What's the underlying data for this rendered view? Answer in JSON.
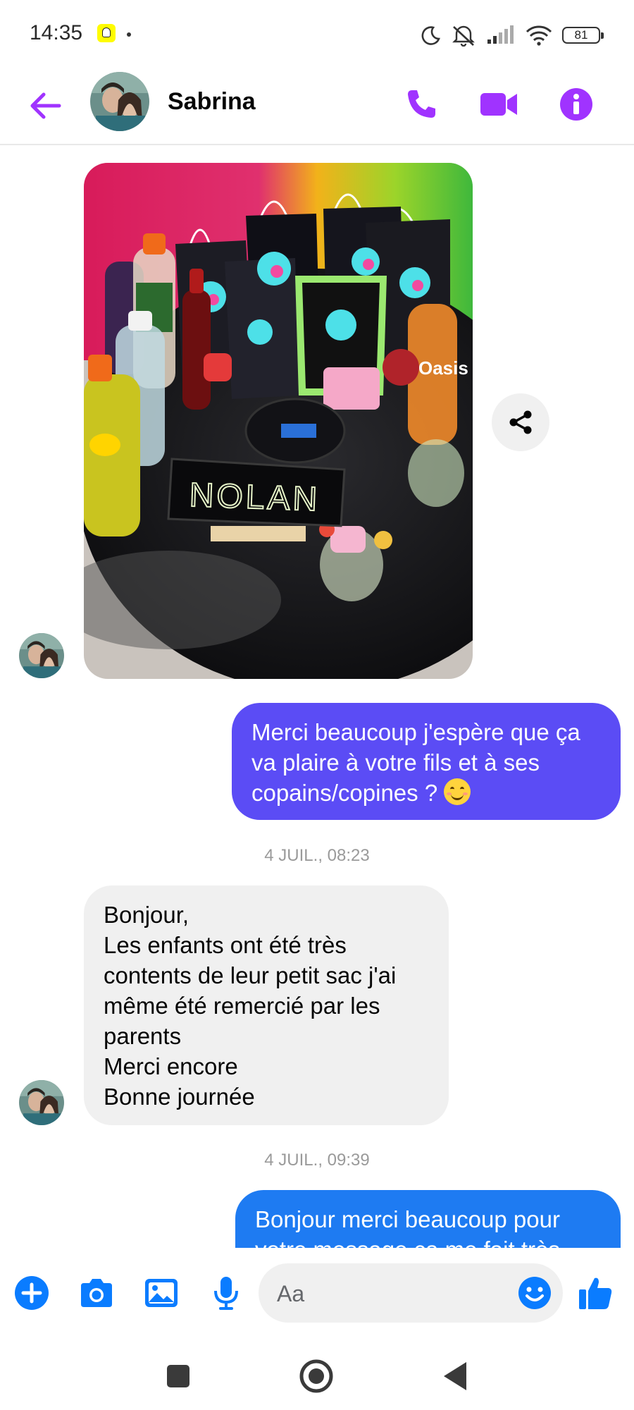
{
  "status_bar": {
    "time": "14:35",
    "battery": "81",
    "icons": [
      "snapchat-icon",
      "moon-icon",
      "mute-icon",
      "signal-icon",
      "wifi-icon",
      "battery-icon"
    ]
  },
  "header": {
    "contact_name": "Sabrina",
    "icons": [
      "back-arrow-icon",
      "phone-icon",
      "video-camera-icon",
      "info-icon"
    ]
  },
  "colors": {
    "accent": "#A033FF",
    "outgoing_bubble_1": "#5B4CF5",
    "outgoing_bubble_2": "#1E7BF2",
    "incoming_bubble": "#F0F0F0",
    "composer_blue": "#0A7CFF"
  },
  "messages": [
    {
      "type": "image",
      "direction": "incoming",
      "photo_label": "NOLAN"
    },
    {
      "type": "text",
      "direction": "outgoing",
      "text": "Merci beaucoup j'espère que ça va plaire à votre fils et à ses copains/copines ?"
    },
    {
      "type": "timestamp",
      "text": "4 JUIL., 08:23"
    },
    {
      "type": "text",
      "direction": "incoming",
      "text": "Bonjour,\nLes enfants ont été très contents de leur petit sac j'ai même été remercié par les parents\nMerci encore\nBonne journée"
    },
    {
      "type": "timestamp",
      "text": "4 JUIL., 09:39"
    },
    {
      "type": "text",
      "direction": "outgoing",
      "text": "Bonjour merci beaucoup pour votre message ça me fait très"
    }
  ],
  "composer": {
    "placeholder": "Aa",
    "icons": [
      "plus-icon",
      "camera-icon",
      "gallery-icon",
      "microphone-icon",
      "emoji-icon",
      "thumbs-up-icon"
    ]
  },
  "nav": {
    "icons": [
      "recents-square-icon",
      "home-circle-icon",
      "back-triangle-icon"
    ]
  }
}
